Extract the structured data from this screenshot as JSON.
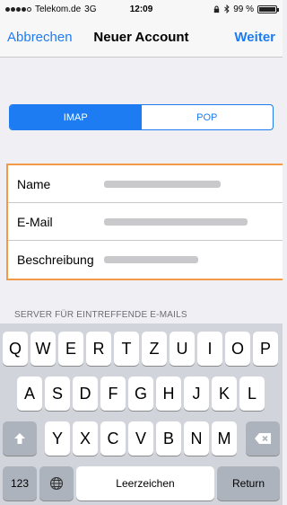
{
  "status_bar": {
    "carrier": "Telekom.de",
    "network": "3G",
    "time": "12:09",
    "battery": "99 %",
    "battery_level": 0.99
  },
  "nav": {
    "cancel": "Abbrechen",
    "title": "Neuer Account",
    "next": "Weiter"
  },
  "segments": {
    "selected": "IMAP",
    "items": [
      "IMAP",
      "POP"
    ]
  },
  "form": {
    "rows": [
      {
        "label": "Name"
      },
      {
        "label": "E-Mail"
      },
      {
        "label": "Beschreibung"
      }
    ]
  },
  "section_header": "SERVER FÜR EINTREFFENDE E-MAILS",
  "keyboard": {
    "row1": [
      "Q",
      "W",
      "E",
      "R",
      "T",
      "Z",
      "U",
      "I",
      "O",
      "P"
    ],
    "row2": [
      "A",
      "S",
      "D",
      "F",
      "G",
      "H",
      "J",
      "K",
      "L"
    ],
    "row3": [
      "Y",
      "X",
      "C",
      "V",
      "B",
      "N",
      "M"
    ],
    "numbers_key": "123",
    "space_key": "Leerzeichen",
    "return_key": "Return"
  },
  "icons": {
    "shift": "shift-arrow-icon",
    "backspace": "backspace-icon",
    "globe": "globe-icon",
    "bluetooth": "bluetooth-icon",
    "lock": "rotation-lock-icon"
  },
  "colors": {
    "accent": "#1e7cf2",
    "highlight": "#f39a48",
    "background": "#efeff4"
  }
}
